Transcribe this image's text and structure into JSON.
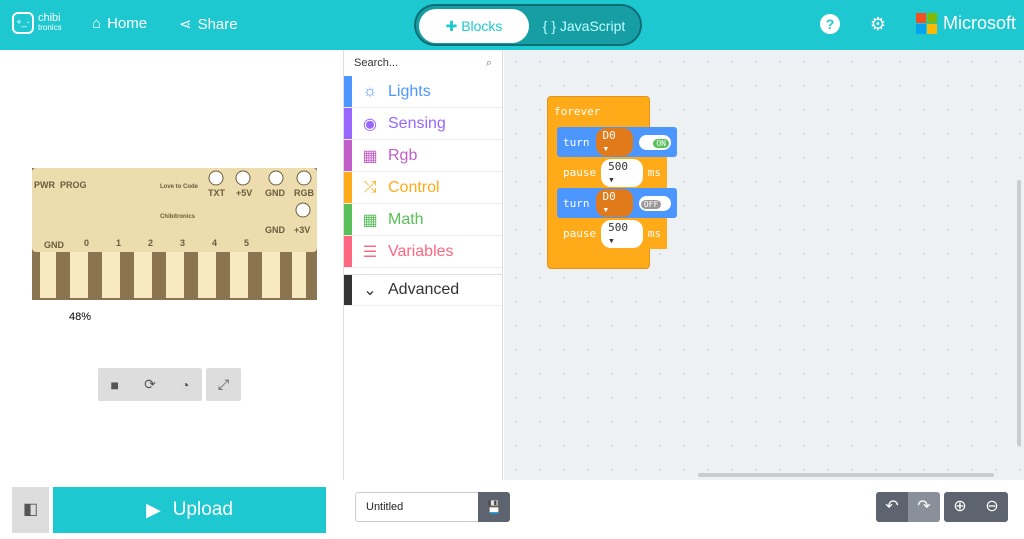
{
  "header": {
    "logo_top": "chibi",
    "logo_bottom": "tronics",
    "home": "Home",
    "share": "Share",
    "tabs": [
      {
        "label": "Blocks",
        "icon": "puzzle-icon"
      },
      {
        "label": "JavaScript",
        "icon": "braces-icon"
      }
    ],
    "help_icon": "?",
    "settings_icon": "⚙",
    "brand": "Microsoft"
  },
  "simulator": {
    "percent": "48%",
    "board": {
      "top": [
        "PWR",
        "PROG",
        "Love to Code",
        "Chibitronics",
        "TXT",
        "+5V",
        "GND",
        "RGB",
        "GND",
        "+3V"
      ],
      "pins": [
        "GND",
        "0",
        "1",
        "2",
        "3",
        "4",
        "5"
      ]
    }
  },
  "toolbox": {
    "search_placeholder": "Search...",
    "categories": [
      {
        "label": "Lights",
        "color": "#4c97ff",
        "icon": "☼"
      },
      {
        "label": "Sensing",
        "color": "#9966ff",
        "icon": "◉"
      },
      {
        "label": "Rgb",
        "color": "#c25ec8",
        "icon": "▦"
      },
      {
        "label": "Control",
        "color": "#ffab19",
        "icon": "⤮"
      },
      {
        "label": "Math",
        "color": "#59c059",
        "icon": "▦"
      },
      {
        "label": "Variables",
        "color": "#ff6680",
        "icon": "☰"
      }
    ],
    "advanced": "Advanced"
  },
  "blocks": {
    "forever": "forever",
    "turn": "turn",
    "pin": "D0",
    "on": "ON",
    "off": "OFF",
    "pause": "pause",
    "ms": "500",
    "unit": "ms"
  },
  "footer": {
    "upload": "Upload",
    "project_name": "Untitled"
  },
  "colors": {
    "accent": "#1ec8d0",
    "control": "#ffab19",
    "lights": "#4c97ff"
  }
}
